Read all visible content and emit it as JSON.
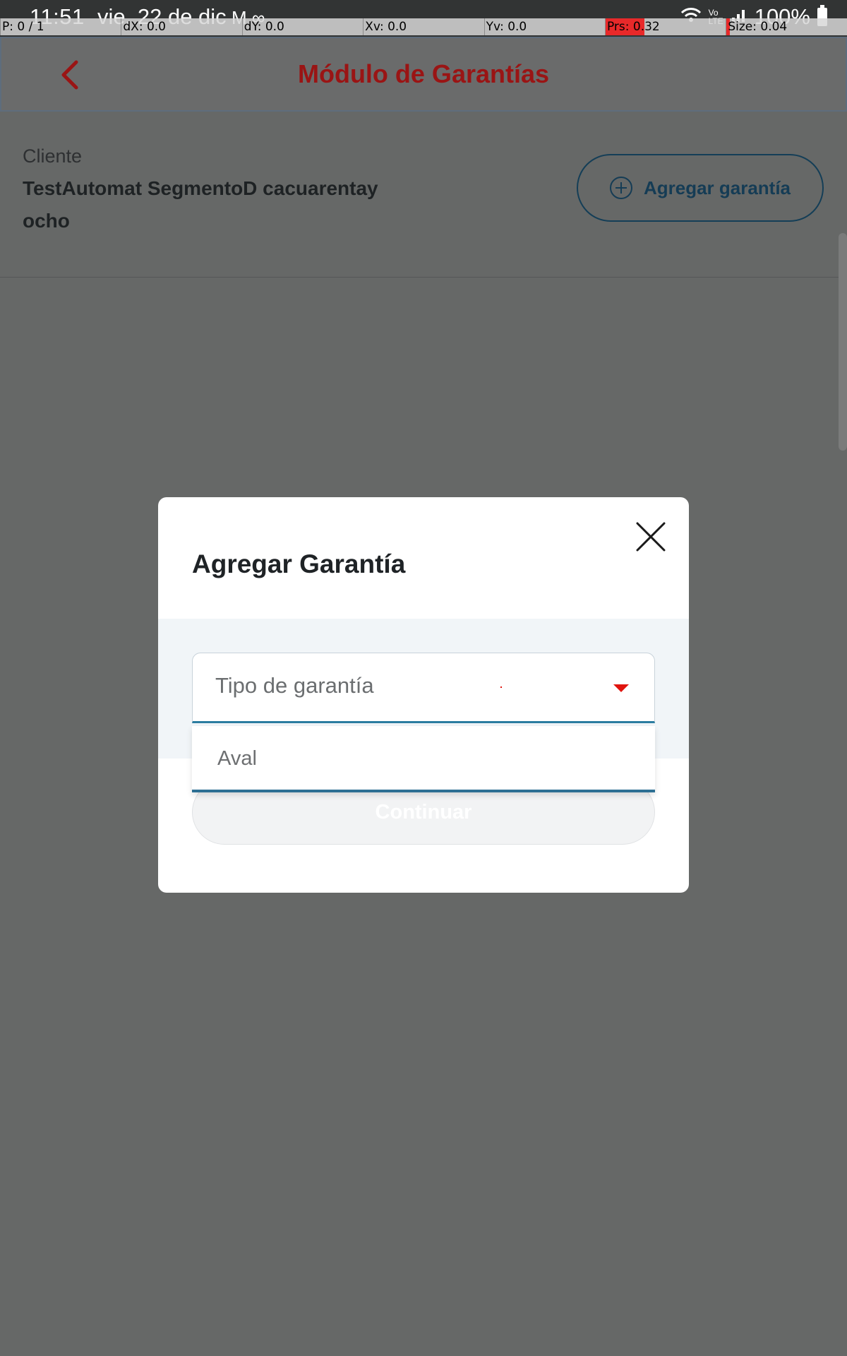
{
  "status_bar": {
    "time": "11:51",
    "date": "vie, 22 de dic",
    "notification_icons": [
      "gmail-icon",
      "voicemail-icon"
    ],
    "notification_glyphs": "M ∞",
    "battery": "100%",
    "right_icons": [
      "wifi-icon",
      "volte-icon",
      "signal-icon",
      "battery-icon"
    ]
  },
  "pointer_overlay": {
    "p": "P: 0 / 1",
    "dx": "dX: 0.0",
    "dy": "dY: 0.0",
    "xv": "Xv: 0.0",
    "yv": "Yv: 0.0",
    "prs": "Prs: 0.32",
    "size": "Size: 0.04"
  },
  "header": {
    "title": "Módulo de Garantías",
    "back_icon": "chevron-left-icon"
  },
  "client": {
    "label": "Cliente",
    "name": "TestAutomat SegmentoD cacuarentay ocho"
  },
  "add_button": {
    "label": "Agregar garantía",
    "icon": "plus-circle-icon"
  },
  "modal": {
    "title": "Agregar Garantía",
    "close_icon": "close-icon",
    "select": {
      "placeholder": "Tipo de garantía",
      "options": [
        "Aval"
      ]
    },
    "continue_label": "Continuar"
  },
  "colors": {
    "accent_red": "#9a1414",
    "caret_red": "#e0140e",
    "primary_blue": "#153c55",
    "focus_blue": "#2b7da0",
    "scrim": "#666867"
  }
}
